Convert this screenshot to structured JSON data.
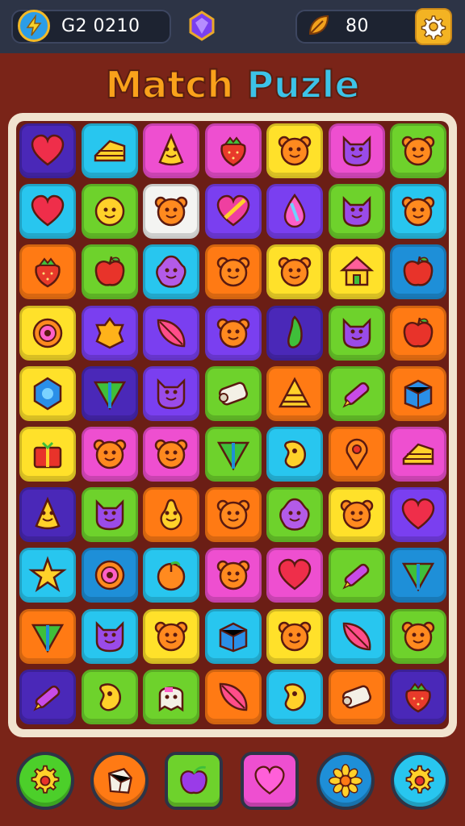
{
  "header": {
    "score": "G2 0210",
    "coins": "80",
    "score_icon": "lightning-refresh-icon",
    "gem_icon": "purple-gem-icon",
    "coin_icon": "leaf-coin-icon",
    "settings_icon": "gear-icon"
  },
  "title": {
    "part1": "Match",
    "part2": "Puzle"
  },
  "colors": {
    "purple": "#7a3ff0",
    "cyan": "#28c6ef",
    "pink": "#ee4fd0",
    "yellow": "#ffe12a",
    "green": "#6ed22c",
    "orange": "#ff7a14",
    "blue": "#1e8fd8",
    "white": "#f4f4f2",
    "darkpurple": "#4a28b8"
  },
  "board": {
    "rows": [
      [
        [
          "darkpurple",
          "heart"
        ],
        [
          "cyan",
          "cheese"
        ],
        [
          "pink",
          "star-face"
        ],
        [
          "pink",
          "strawberry"
        ],
        [
          "yellow",
          "bear"
        ],
        [
          "pink",
          "cat"
        ],
        [
          "green",
          "bear"
        ]
      ],
      [
        [
          "cyan",
          "heart"
        ],
        [
          "green",
          "smiley"
        ],
        [
          "white",
          "bear"
        ],
        [
          "purple",
          "heart-stripe"
        ],
        [
          "purple",
          "drop"
        ],
        [
          "green",
          "cat"
        ],
        [
          "cyan",
          "bear"
        ]
      ],
      [
        [
          "orange",
          "strawberry"
        ],
        [
          "green",
          "apple"
        ],
        [
          "cyan",
          "blob"
        ],
        [
          "orange",
          "bear"
        ],
        [
          "yellow",
          "bear"
        ],
        [
          "yellow",
          "house"
        ],
        [
          "blue",
          "apple"
        ]
      ],
      [
        [
          "yellow",
          "donut"
        ],
        [
          "purple",
          "lemon"
        ],
        [
          "purple",
          "leaf"
        ],
        [
          "purple",
          "bear"
        ],
        [
          "darkpurple",
          "pepper"
        ],
        [
          "green",
          "cat"
        ],
        [
          "orange",
          "apple"
        ]
      ],
      [
        [
          "yellow",
          "hexagon"
        ],
        [
          "darkpurple",
          "triangle"
        ],
        [
          "purple",
          "cat"
        ],
        [
          "green",
          "scroll"
        ],
        [
          "orange",
          "pyramid"
        ],
        [
          "green",
          "crayon"
        ],
        [
          "orange",
          "box"
        ]
      ],
      [
        [
          "yellow",
          "gift"
        ],
        [
          "pink",
          "bear"
        ],
        [
          "pink",
          "bear"
        ],
        [
          "green",
          "triangle"
        ],
        [
          "cyan",
          "mango"
        ],
        [
          "orange",
          "pin"
        ],
        [
          "pink",
          "cheese"
        ]
      ],
      [
        [
          "darkpurple",
          "star-face"
        ],
        [
          "green",
          "cat"
        ],
        [
          "orange",
          "pear"
        ],
        [
          "orange",
          "bear"
        ],
        [
          "green",
          "blob"
        ],
        [
          "yellow",
          "bear"
        ],
        [
          "purple",
          "heart"
        ]
      ],
      [
        [
          "cyan",
          "star"
        ],
        [
          "blue",
          "donut"
        ],
        [
          "cyan",
          "peach"
        ],
        [
          "pink",
          "bear"
        ],
        [
          "pink",
          "heart"
        ],
        [
          "green",
          "crayon"
        ],
        [
          "blue",
          "triangle"
        ]
      ],
      [
        [
          "orange",
          "triangle"
        ],
        [
          "cyan",
          "cat"
        ],
        [
          "yellow",
          "bear"
        ],
        [
          "cyan",
          "box"
        ],
        [
          "yellow",
          "bear"
        ],
        [
          "cyan",
          "leaf"
        ],
        [
          "green",
          "bear"
        ]
      ],
      [
        [
          "darkpurple",
          "crayon"
        ],
        [
          "green",
          "mango"
        ],
        [
          "green",
          "ghost"
        ],
        [
          "orange",
          "leaf"
        ],
        [
          "cyan",
          "mango"
        ],
        [
          "orange",
          "scroll"
        ],
        [
          "darkpurple",
          "strawberry"
        ]
      ]
    ]
  },
  "bottom": [
    {
      "color": "#4ccf2a",
      "icon": "gear-icon",
      "shape": "circle"
    },
    {
      "color": "#ff7a14",
      "icon": "box-icon",
      "shape": "circle"
    },
    {
      "color": "#6ed22c",
      "icon": "apple-icon",
      "shape": "square"
    },
    {
      "color": "#ee4fd0",
      "icon": "heart-icon",
      "shape": "square"
    },
    {
      "color": "#1e8fd8",
      "icon": "flower-icon",
      "shape": "circle"
    },
    {
      "color": "#28c6ef",
      "icon": "gear-icon",
      "shape": "circle"
    }
  ]
}
